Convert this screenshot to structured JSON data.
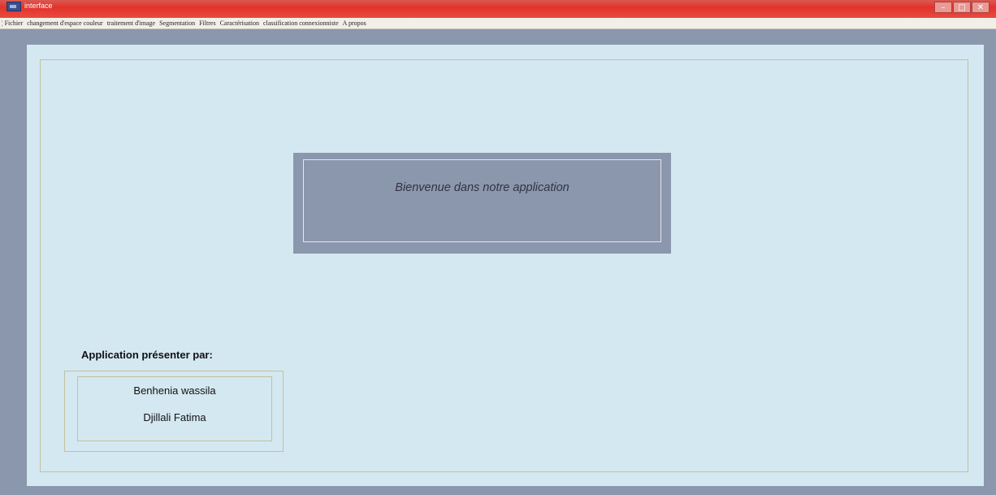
{
  "window": {
    "title": "interface",
    "controls": {
      "minimize": "–",
      "maximize": "□",
      "close": "✕"
    }
  },
  "menubar": {
    "bullet": "¦",
    "items": [
      "Fichier",
      "changement d'espace couleur",
      "traitement d'image",
      "Segmentation",
      "Filtres",
      "Caractérisation",
      "classification connexionniste",
      "A propos"
    ]
  },
  "main": {
    "welcome_text": "Bienvenue dans notre application",
    "presented_label": "Application présenter par:",
    "authors": [
      "Benhenia wassila",
      "Djillali Fatima"
    ]
  },
  "colors": {
    "titlebar": "#e2332a",
    "frame": "#8a97ad",
    "panel": "#d4e8f2",
    "welcome_box": "#8a97ad",
    "frame_line": "#c4c09b"
  },
  "icons": {
    "app": "app-icon"
  }
}
